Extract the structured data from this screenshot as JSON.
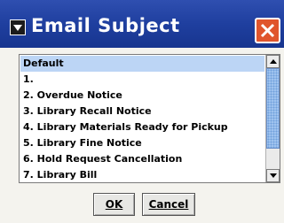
{
  "window": {
    "title": "Email Subject",
    "icon": "window-menu-icon",
    "close_icon": "close-icon"
  },
  "list": {
    "items": [
      "Default",
      "1.",
      "2. Overdue Notice",
      "3. Library Recall Notice",
      "4. Library Materials Ready for Pickup",
      "5. Library Fine Notice",
      "6. Hold Request Cancellation",
      "7. Library Bill"
    ],
    "selected_index": 0
  },
  "buttons": {
    "ok_label": "OK",
    "cancel_label": "Cancel"
  },
  "colors": {
    "title_bar": "#1f3f9f",
    "close_button": "#e0552c",
    "selection": "#bcd5f5",
    "scroll_thumb": "#9fc3ef"
  }
}
